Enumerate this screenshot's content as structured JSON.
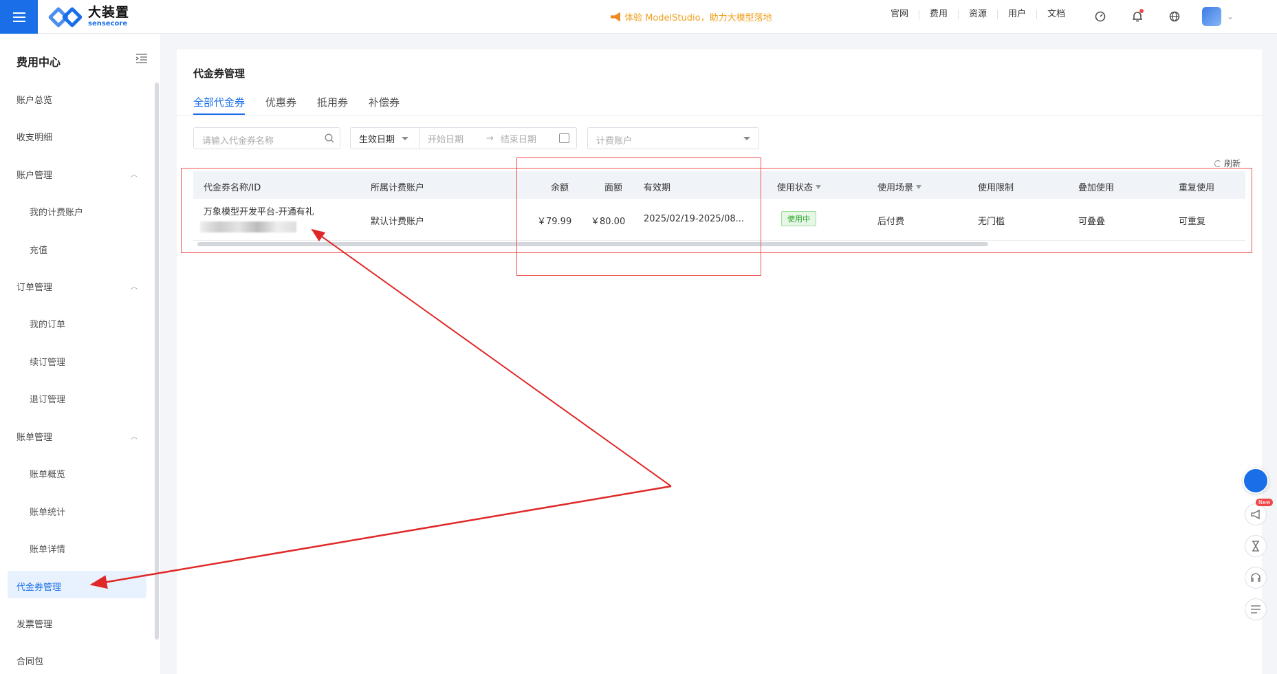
{
  "topbar": {
    "logo_zh": "大装置",
    "logo_en": "sensecore",
    "promo": "体验 ModelStudio，助力大模型落地",
    "nav": [
      "官网",
      "费用",
      "资源",
      "用户",
      "文档"
    ]
  },
  "sidebar": {
    "title": "费用中心",
    "items": {
      "overview": "账户总览",
      "income": "收支明细",
      "account_mgmt": "账户管理",
      "my_billing_account": "我的计费账户",
      "recharge": "充值",
      "order_mgmt": "订单管理",
      "my_orders": "我的订单",
      "renew": "续订管理",
      "unsubscribe": "退订管理",
      "bill_mgmt": "账单管理",
      "bill_overview": "账单概览",
      "bill_stats": "账单统计",
      "bill_detail": "账单详情",
      "voucher_mgmt": "代金券管理",
      "invoice_mgmt": "发票管理",
      "contract": "合同包"
    }
  },
  "main": {
    "title": "代金券管理",
    "tabs": [
      "全部代金券",
      "优惠券",
      "抵用券",
      "补偿券"
    ],
    "search_placeholder": "请输入代金券名称",
    "date_type": "生效日期",
    "start_placeholder": "开始日期",
    "range_sep": "→",
    "end_placeholder": "结束日期",
    "billing_placeholder": "计费账户",
    "refresh": "刷新",
    "columns": [
      "代金券名称/ID",
      "所属计费账户",
      "余额",
      "面额",
      "有效期",
      "使用状态",
      "使用场景",
      "使用限制",
      "叠加使用",
      "重复使用"
    ],
    "rows": [
      {
        "name": "万象模型开发平台-开通有礼",
        "account": "默认计费账户",
        "balance": "￥79.99",
        "face_value": "￥80.00",
        "validity": "2025/02/19-2025/08...",
        "status": "使用中",
        "scene": "后付费",
        "limit": "无门槛",
        "stack": "可叠叠",
        "repeat": "可重复"
      }
    ]
  },
  "floating": {
    "new_badge": "New"
  },
  "colors": {
    "brand": "#1a6fe8",
    "annotation": "#f05050",
    "promo": "#f0a020"
  }
}
